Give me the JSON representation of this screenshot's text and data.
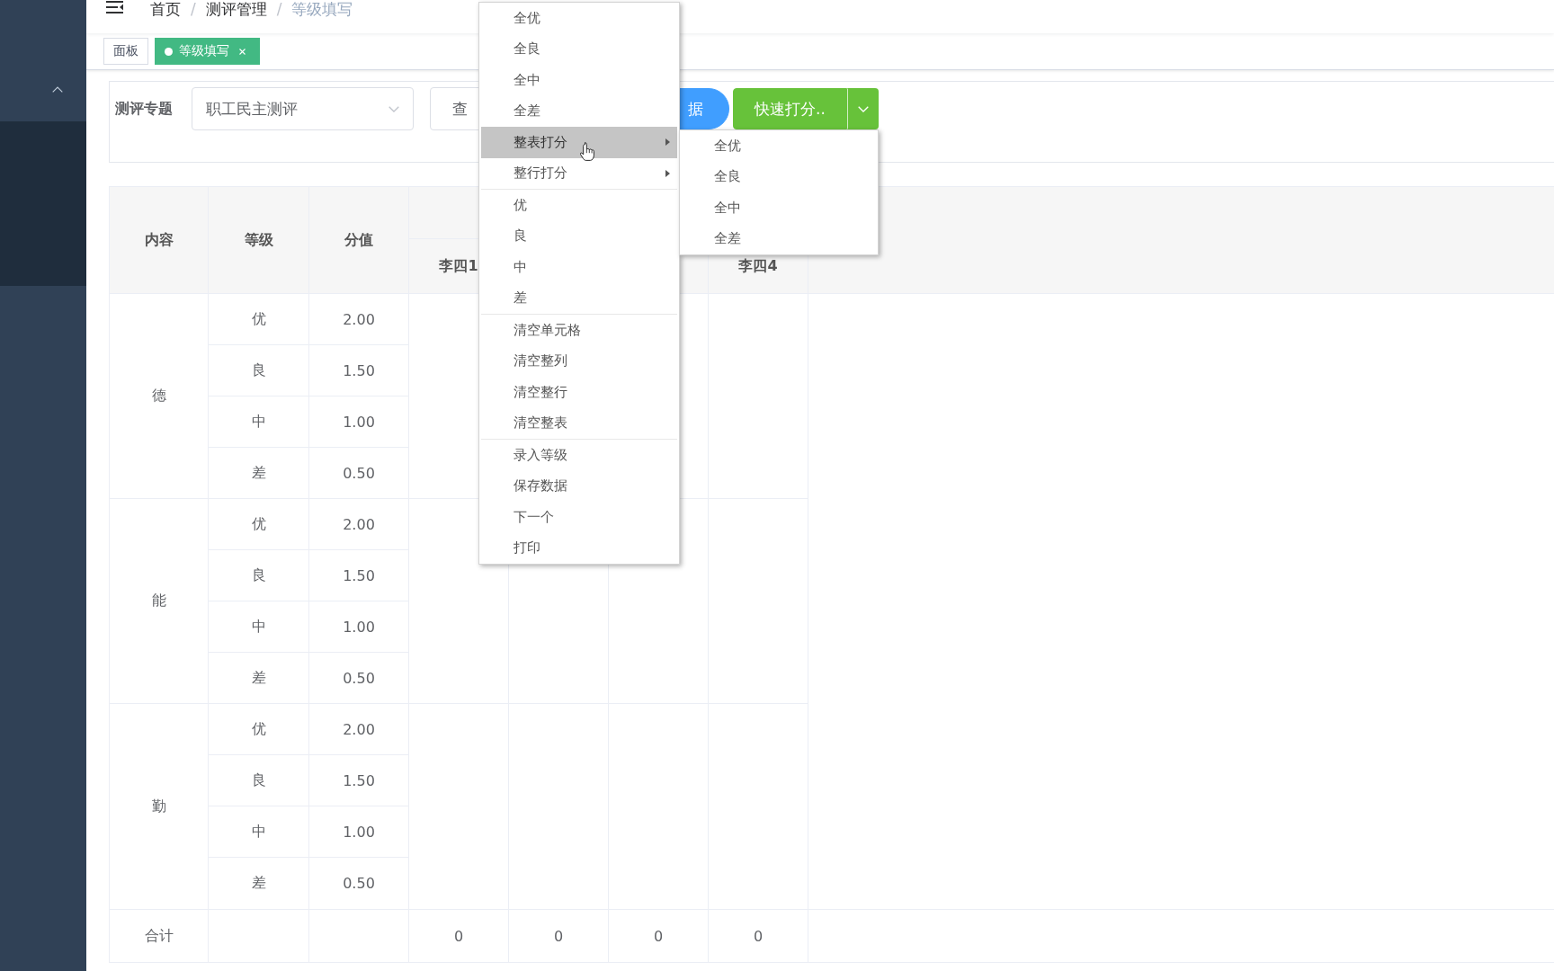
{
  "sidebar": {
    "menu_expanded": true
  },
  "navbar": {
    "breadcrumb": [
      {
        "label": "首页",
        "current": false,
        "separator": "/"
      },
      {
        "label": "测评管理",
        "current": false,
        "separator": "/"
      },
      {
        "label": "等级填写",
        "current": true
      }
    ]
  },
  "tags": [
    {
      "label": "面板",
      "selected": false,
      "closable": false
    },
    {
      "label": "等级填写",
      "selected": true,
      "closable": true
    }
  ],
  "filter": {
    "label": "测评专题",
    "select": {
      "value": "职工民主测评"
    },
    "buttons": [
      {
        "kind": "default",
        "label": "查"
      },
      {
        "kind": "primary",
        "label": "据"
      }
    ],
    "split_button": {
      "label": "快速打分.."
    }
  },
  "table": {
    "columns": [
      {
        "label": "内容"
      },
      {
        "label": "等级"
      },
      {
        "label": "分值"
      }
    ],
    "people": [
      {
        "label": "李四1",
        "total": "0"
      },
      {
        "total": "0"
      },
      {
        "total": "0"
      },
      {
        "label": "李四4",
        "total": "0"
      }
    ],
    "groups": [
      {
        "content": "德",
        "rows": [
          {
            "grade": "优",
            "score": "2.00"
          },
          {
            "grade": "良",
            "score": "1.50"
          },
          {
            "grade": "中",
            "score": "1.00"
          },
          {
            "grade": "差",
            "score": "0.50"
          }
        ]
      },
      {
        "content": "能",
        "rows": [
          {
            "grade": "优",
            "score": "2.00"
          },
          {
            "grade": "良",
            "score": "1.50"
          },
          {
            "grade": "中",
            "score": "1.00"
          },
          {
            "grade": "差",
            "score": "0.50"
          }
        ]
      },
      {
        "content": "勤",
        "rows": [
          {
            "grade": "优",
            "score": "2.00"
          },
          {
            "grade": "良",
            "score": "1.50"
          },
          {
            "grade": "中",
            "score": "1.00"
          },
          {
            "grade": "差",
            "score": "0.50"
          }
        ]
      }
    ],
    "footer": {
      "label": "合计"
    }
  },
  "context_menu": {
    "sections": [
      {
        "items": [
          {
            "kind": "action",
            "label": "全优",
            "selected": false
          },
          {
            "kind": "action",
            "label": "全良",
            "selected": false
          },
          {
            "kind": "action",
            "label": "全中",
            "selected": false
          },
          {
            "kind": "action",
            "label": "全差",
            "selected": false
          },
          {
            "kind": "submenu",
            "label": "整表打分",
            "selected": true,
            "submenu": [
              {
                "label": "全优",
                "selected": false
              },
              {
                "label": "全良",
                "selected": false
              },
              {
                "label": "全中",
                "selected": false
              },
              {
                "label": "全差",
                "selected": false
              }
            ]
          },
          {
            "kind": "submenu",
            "label": "整行打分",
            "selected": false
          }
        ]
      },
      {
        "items": [
          {
            "kind": "action",
            "label": "优",
            "selected": false
          },
          {
            "kind": "action",
            "label": "良",
            "selected": false
          },
          {
            "kind": "action",
            "label": "中",
            "selected": false
          },
          {
            "kind": "action",
            "label": "差",
            "selected": false
          }
        ]
      },
      {
        "items": [
          {
            "kind": "action",
            "label": "清空单元格",
            "selected": false
          },
          {
            "kind": "action",
            "label": "清空整列",
            "selected": false
          },
          {
            "kind": "action",
            "label": "清空整行",
            "selected": false
          },
          {
            "kind": "action",
            "label": "清空整表",
            "selected": false
          }
        ]
      },
      {
        "items": [
          {
            "kind": "action",
            "label": "录入等级",
            "selected": false
          },
          {
            "kind": "action",
            "label": "保存数据",
            "selected": false
          },
          {
            "kind": "action",
            "label": "下一个",
            "selected": false
          },
          {
            "kind": "action",
            "label": "打印",
            "selected": false
          }
        ]
      }
    ]
  }
}
